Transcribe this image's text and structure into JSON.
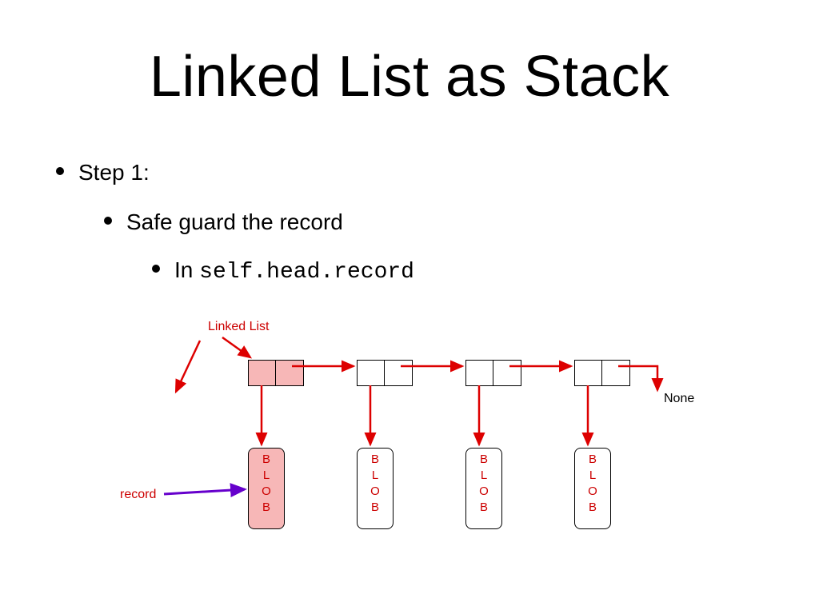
{
  "title": "Linked List as Stack",
  "bullets": {
    "l1": "Step 1:",
    "l2": "Safe guard the record",
    "l3_prefix": "In ",
    "l3_code": "self.head.record"
  },
  "diagram": {
    "linked_list_label": "Linked List",
    "record_label": "record",
    "none_label": "None",
    "blob_text": "B\nL\nO\nB"
  }
}
